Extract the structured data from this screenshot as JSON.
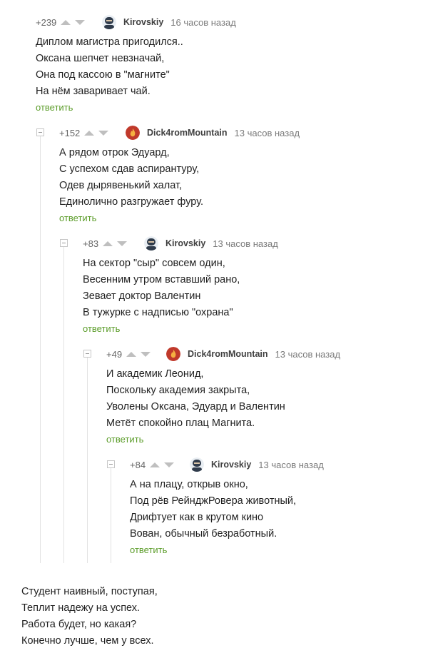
{
  "comments": [
    {
      "score": "+239",
      "user": "Kirovskiy",
      "time": "16 часов назад",
      "lines": [
        "Диплом магистра пригодился..",
        "Оксана шепчет невзначай,",
        "Она под кассою в \"магните\"",
        "На нём заваривает чай."
      ],
      "reply": "ответить",
      "avatar": "ninja-avatar-icon"
    },
    {
      "score": "+152",
      "user": "Dick4romMountain",
      "time": "13 часов назад",
      "lines": [
        "А рядом отрок Эдуард,",
        "С успехом сдав аспирантуру,",
        "Одев дырявенький халат,",
        "Единолично разгружает фуру."
      ],
      "reply": "ответить",
      "avatar": "flame-avatar-icon"
    },
    {
      "score": "+83",
      "user": "Kirovskiy",
      "time": "13 часов назад",
      "lines": [
        "На сектор \"сыр\" совсем один,",
        "Весенним утром вставший рано,",
        "Зевает доктор Валентин",
        "В тужурке с надписью \"охрана\""
      ],
      "reply": "ответить",
      "avatar": "ninja-avatar-icon"
    },
    {
      "score": "+49",
      "user": "Dick4romMountain",
      "time": "13 часов назад",
      "lines": [
        "И академик Леонид,",
        "Поскольку академия закрыта,",
        "Уволены Оксана, Эдуард и Валентин",
        "Метёт спокойно плац Магнита."
      ],
      "reply": "ответить",
      "avatar": "flame-avatar-icon"
    },
    {
      "score": "+84",
      "user": "Kirovskiy",
      "time": "13 часов назад",
      "lines": [
        "А на плацу, открыв окно,",
        "Под рёв РейнджРовера животный,",
        "Дрифтует как в крутом кино",
        "Вован, обычный безработный."
      ],
      "reply": "ответить",
      "avatar": "ninja-avatar-icon"
    }
  ],
  "poem": [
    "Студент наивный, поступая,",
    "Теплит надежу на успех.",
    "Работа будет, но какая?",
    "Конечно лучше, чем у всех."
  ],
  "colors": {
    "reply_link": "#5b9c29",
    "vote_arrow": "#bfbfbf",
    "text": "#1f1f1f"
  }
}
